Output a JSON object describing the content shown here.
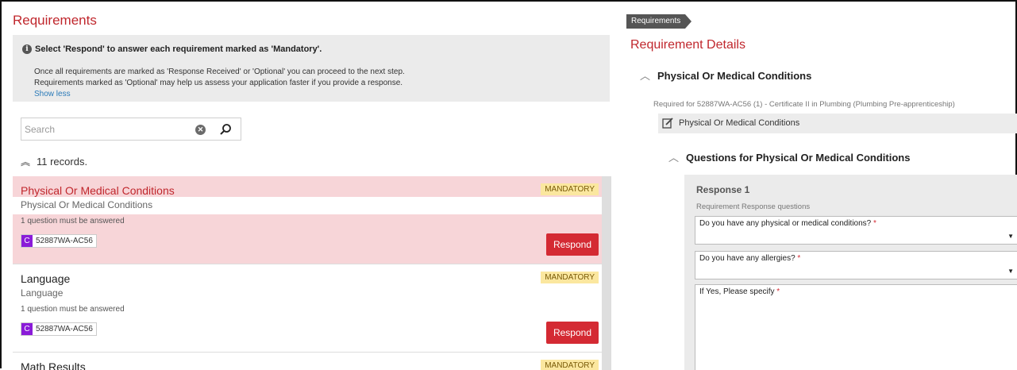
{
  "left": {
    "title": "Requirements",
    "info": {
      "heading": "Select 'Respond' to answer each requirement marked as 'Mandatory'.",
      "line1": "Once all requirements are marked as 'Response Received' or 'Optional' you can proceed to the next step.",
      "line2": "Requirements marked as 'Optional' may help us assess your application faster if you provide a response.",
      "toggle": "Show less"
    },
    "search": {
      "placeholder": "Search",
      "value": ""
    },
    "records": "11 records.",
    "items": [
      {
        "name": "Physical Or Medical Conditions",
        "sub": "Physical Or Medical Conditions",
        "note": "1 question must be answered",
        "tag_letter": "C",
        "tag_code": "52887WA-AC56",
        "badge": "MANDATORY",
        "button": "Respond"
      },
      {
        "name": "Language",
        "sub": "Language",
        "note": "1 question must be answered",
        "tag_letter": "C",
        "tag_code": "52887WA-AC56",
        "badge": "MANDATORY",
        "button": "Respond"
      },
      {
        "name": "Math Results",
        "badge": "MANDATORY"
      }
    ]
  },
  "right": {
    "breadcrumb": "Requirements",
    "title": "Requirement Details",
    "section": "Physical Or Medical Conditions",
    "required_for": "Required for 52887WA-AC56 (1) - Certificate II in Plumbing (Plumbing Pre-apprenticeship)",
    "doc_label": "Physical Or Medical Conditions",
    "questions_title": "Questions for Physical Or Medical Conditions",
    "response": {
      "title": "Response 1",
      "subtitle": "Requirement Response questions",
      "q1": "Do you have any physical or medical conditions?",
      "q2": "Do you have any allergies?",
      "q3": "If Yes, Please specify",
      "required_mark": "*"
    }
  },
  "colors": {
    "accent": "#c0272d",
    "button": "#d42a33",
    "badge": "#fbe79f",
    "tag": "#8a1bd8"
  }
}
